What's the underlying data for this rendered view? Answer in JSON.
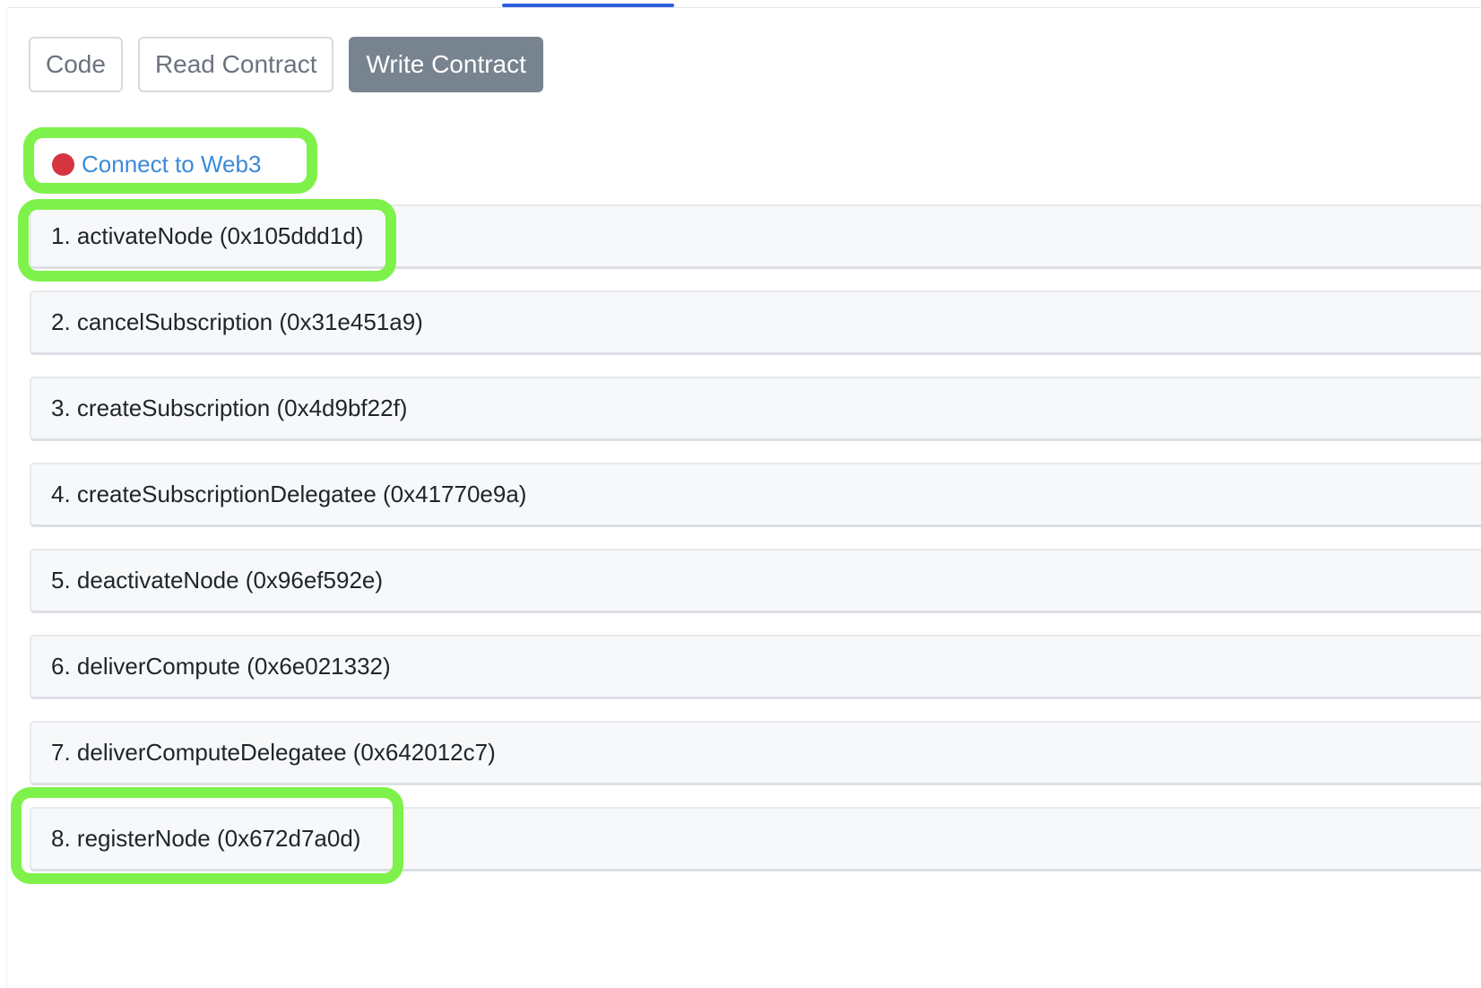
{
  "tabs": {
    "buttons": [
      {
        "label": "Code",
        "active": false
      },
      {
        "label": "Read Contract",
        "active": false
      },
      {
        "label": "Write Contract",
        "active": true
      }
    ]
  },
  "connect": {
    "label": "Connect to Web3",
    "status_color": "#d6343f"
  },
  "functions": [
    {
      "label": "1. activateNode (0x105ddd1d)"
    },
    {
      "label": "2. cancelSubscription (0x31e451a9)"
    },
    {
      "label": "3. createSubscription (0x4d9bf22f)"
    },
    {
      "label": "4. createSubscriptionDelegatee (0x41770e9a)"
    },
    {
      "label": "5. deactivateNode (0x96ef592e)"
    },
    {
      "label": "6. deliverCompute (0x6e021332)"
    },
    {
      "label": "7. deliverComputeDelegatee (0x642012c7)"
    },
    {
      "label": "8. registerNode (0x672d7a0d)"
    }
  ],
  "colors": {
    "accent": "#2f5fe0",
    "highlight": "#7ef24a",
    "link": "#3b8ad9",
    "active_button": "#77838f"
  }
}
